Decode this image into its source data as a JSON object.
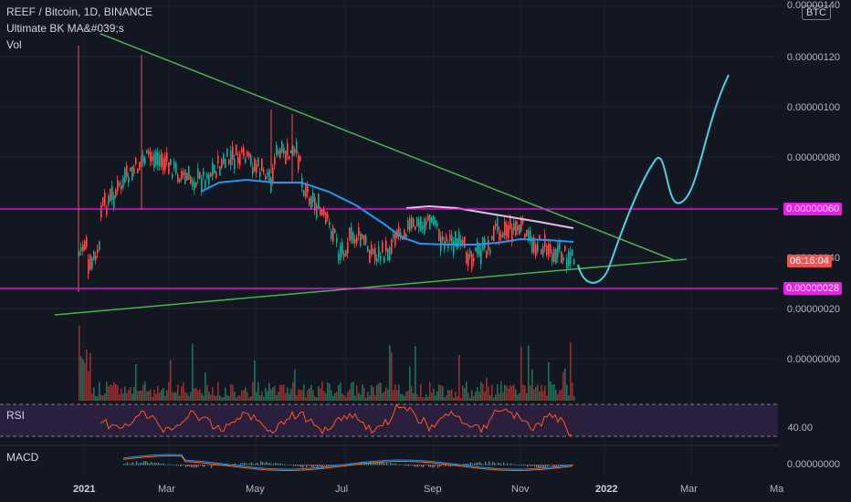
{
  "header": {
    "symbol_line": "REEF / Bitcoin, 1D, BINANCE",
    "indicator_line": "Ultimate BK MA&#039;s",
    "volume_line": "Vol"
  },
  "currency_badge": "BTC",
  "price_axis": {
    "labels": [
      "0.00000140",
      "0.00000120",
      "0.00000100",
      "0.00000080",
      "0.00000040",
      "0.00000020",
      "0.00000000"
    ],
    "tag_upper": "0.00000060",
    "tag_countdown": "06:16:04",
    "tag_lower": "0.00000028"
  },
  "rsi": {
    "label": "RSI",
    "level": "40.00"
  },
  "macd": {
    "label": "MACD",
    "level": "0.00000000"
  },
  "time_axis": [
    "2021",
    "Mar",
    "May",
    "Jul",
    "Sep",
    "Nov",
    "2022",
    "Mar",
    "Ma"
  ],
  "colors": {
    "background": "#131722",
    "up_candle": "#26a69a",
    "down_candle": "#ef5350",
    "trendline": "#4caf50",
    "horizontal_level": "#e91ee9",
    "projection": "#4dd0e1",
    "ma_blue": "#2196f3",
    "ma_pink": "#e1bee7",
    "rsi_line": "#ff5722",
    "rsi_band": "#2a1f3d"
  },
  "chart_data": {
    "type": "candlestick",
    "price_scale": {
      "min": 0.0,
      "max": 1.4e-06
    },
    "trendlines": [
      {
        "name": "",
        "from": [
          "2021-01",
          3e-07
        ],
        "to": [
          "2022-02",
          4e-07
        ]
      },
      {
        "name": "",
        "from": [
          "2021-01",
          1.3e-06
        ],
        "to": [
          "2022-02",
          4.1e-07
        ]
      }
    ],
    "horizontal_levels": [
      6e-07,
      2.8e-07
    ],
    "price_series_approx": [
      {
        "t": "2021-01",
        "p": 5e-07
      },
      {
        "t": "2021-02",
        "p": 9e-07
      },
      {
        "t": "2021-03",
        "p": 8e-07
      },
      {
        "t": "2021-04",
        "p": 7e-07
      },
      {
        "t": "2021-05",
        "p": 8e-07
      },
      {
        "t": "2021-06",
        "p": 6e-07
      },
      {
        "t": "2021-07",
        "p": 4e-07
      },
      {
        "t": "2021-08",
        "p": 4e-07
      },
      {
        "t": "2021-09",
        "p": 5e-07
      },
      {
        "t": "2021-10",
        "p": 4e-07
      },
      {
        "t": "2021-11",
        "p": 5e-07
      },
      {
        "t": "2021-12",
        "p": 4e-07
      }
    ]
  }
}
